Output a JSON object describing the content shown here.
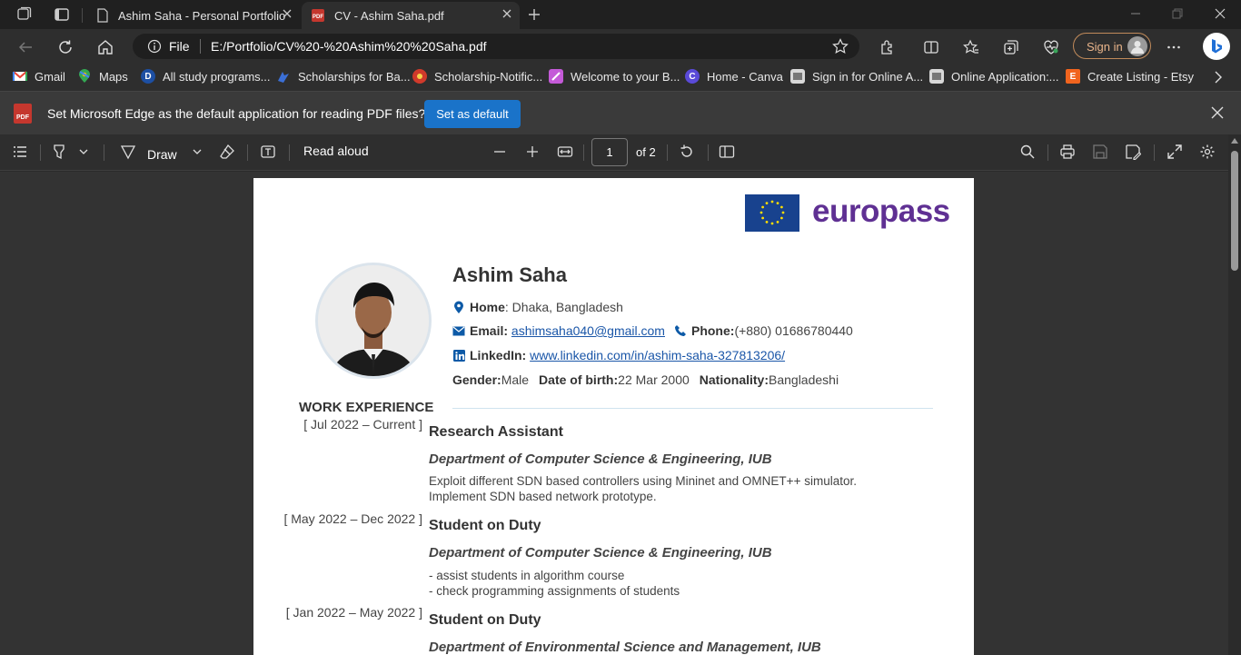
{
  "browser": {
    "tabs": [
      {
        "title": "Ashim Saha - Personal Portfolio",
        "active": false
      },
      {
        "title": "CV - Ashim Saha.pdf",
        "active": true
      }
    ],
    "address": {
      "scheme": "File",
      "url": "E:/Portfolio/CV%20-%20Ashim%20%20Saha.pdf"
    },
    "signin_label": "Sign in"
  },
  "bookmarks": [
    {
      "label": "Gmail",
      "icon": "gmail-icon",
      "color": "#ea4335"
    },
    {
      "label": "Maps",
      "icon": "maps-icon",
      "color": "#34a853"
    },
    {
      "label": "All study programs...",
      "icon": "daad-icon",
      "color": "#1d4fa3"
    },
    {
      "label": "Scholarships for Ba...",
      "icon": "scholarship-icon",
      "color": "#3b6fd6"
    },
    {
      "label": "Scholarship-Notific...",
      "icon": "notification-icon",
      "color": "#d03a2b"
    },
    {
      "label": "Welcome to your B...",
      "icon": "welcome-icon",
      "color": "#c45ad8"
    },
    {
      "label": "Home - Canva",
      "icon": "canva-icon",
      "color": "#5a4ad8"
    },
    {
      "label": "Sign in for Online A...",
      "icon": "signin-site-icon",
      "color": "#cccccc"
    },
    {
      "label": "Online Application:...",
      "icon": "application-icon",
      "color": "#cccccc"
    },
    {
      "label": "Create Listing - Etsy",
      "icon": "etsy-icon",
      "color": "#f1641e"
    }
  ],
  "infobar": {
    "message": "Set Microsoft Edge as the default application for reading PDF files?",
    "button": "Set as default",
    "pdf_badge": "PDF"
  },
  "pdf_toolbar": {
    "draw_label": "Draw",
    "read_aloud_label": "Read aloud",
    "page_current": "1",
    "page_total": "of 2"
  },
  "cv": {
    "brand": "europass",
    "name": "Ashim Saha",
    "home_label": "Home",
    "home_value": " : Dhaka, Bangladesh",
    "email_label": "Email:",
    "email_value": "ashimsaha040@gmail.com",
    "phone_label": "Phone:",
    "phone_value": " (+880) 01686780440",
    "linkedin_label": "LinkedIn:",
    "linkedin_value": "www.linkedin.com/in/ashim-saha-327813206/",
    "gender_label": "Gender:",
    "gender_value": " Male",
    "dob_label": "Date of birth:",
    "dob_value": " 22 Mar 2000",
    "nationality_label": "Nationality:",
    "nationality_value": " Bangladeshi",
    "section_title": "WORK EXPERIENCE",
    "jobs": [
      {
        "date": "[ Jul 2022 – Current ]",
        "title": "Research Assistant",
        "dept": "Department of Computer Science & Engineering, IUB",
        "desc1": "Exploit different SDN based controllers using Mininet and OMNET++ simulator.",
        "desc2": "Implement SDN based network prototype."
      },
      {
        "date": "[ May 2022 – Dec 2022 ]",
        "title": "Student on Duty",
        "dept": "Department of Computer Science & Engineering, IUB",
        "desc1": "- assist students in algorithm course",
        "desc2": "- check programming assignments of students"
      },
      {
        "date": "[ Jan 2022 – May 2022 ]",
        "title": "Student on Duty",
        "dept": "Department of Environmental Science and Management, IUB"
      }
    ]
  }
}
